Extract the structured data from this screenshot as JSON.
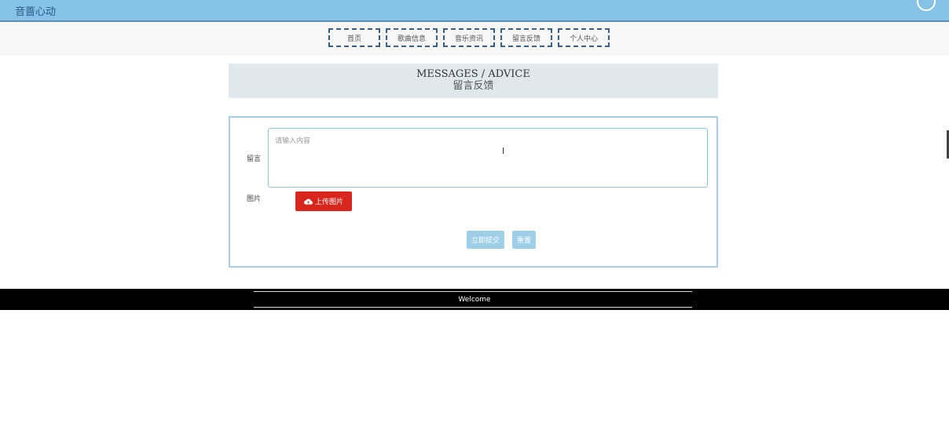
{
  "header": {
    "site_title": "音蔷心动"
  },
  "nav": {
    "items": [
      "首页",
      "歌曲信息",
      "音乐资讯",
      "留言反馈",
      "个人中心"
    ]
  },
  "banner": {
    "title_en": "MESSAGES / ADVICE",
    "title_cn": "留言反馈"
  },
  "form": {
    "message_label": "留言",
    "message_placeholder": "请输入内容",
    "image_label": "图片",
    "upload_label": "上传图片",
    "submit_label": "立即提交",
    "reset_label": "重置"
  },
  "footer": {
    "text": "Welcome"
  },
  "colors": {
    "topbar": "#86c1e6",
    "upload_button": "#d9261c",
    "action_button": "#9fcfe8",
    "footer": "#000000"
  },
  "icons": {
    "upload": "cloud-upload-icon"
  }
}
